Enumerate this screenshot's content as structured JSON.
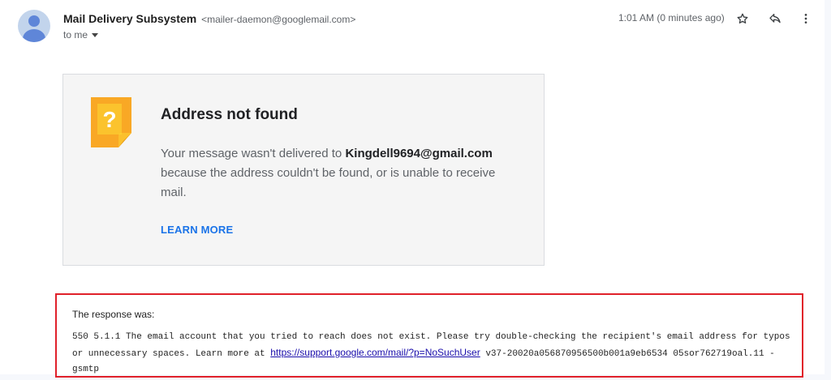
{
  "header": {
    "sender_name": "Mail Delivery Subsystem",
    "sender_email": "<mailer-daemon@googlemail.com>",
    "recipient": "to me",
    "time": "1:01 AM (0 minutes ago)",
    "icons": [
      "avatar-icon",
      "star-icon",
      "reply-icon",
      "more-vert-icon"
    ]
  },
  "notice": {
    "icon": "question-note-icon",
    "title": "Address not found",
    "body_prefix": "Your message wasn't delivered to ",
    "address": "Kingdell9694@gmail.com",
    "body_suffix": " because the address couldn't be found, or is unable to receive mail.",
    "learn_more": "LEARN MORE",
    "colors": {
      "icon": "#f9a825",
      "link": "#1a73e8"
    }
  },
  "response": {
    "label": "The response was:",
    "text_before": "550 5.1.1 The email account that you tried to reach does not exist. Please try double-checking the recipient's email address for typos or unnecessary spaces. Learn more at ",
    "link": "https://support.google.com/mail/?p=NoSuchUser",
    "text_after": " v37-20020a056870956500b001a9eb6534 05sor762719oal.11 - gsmtp",
    "highlight_color": "#e0202a"
  }
}
